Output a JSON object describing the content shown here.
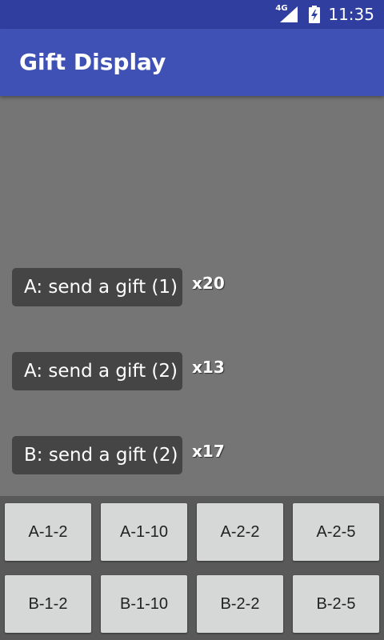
{
  "status_bar": {
    "network": "4G",
    "time": "11:35",
    "icons": [
      "signal-icon",
      "battery-charging-icon"
    ]
  },
  "app_bar": {
    "title": "Gift Display"
  },
  "gifts": [
    {
      "label": "A: send a gift (1)",
      "count": "x20"
    },
    {
      "label": "A: send a gift (2)",
      "count": "x13"
    },
    {
      "label": "B: send a gift (2)",
      "count": "x17"
    }
  ],
  "buttons": {
    "row1": [
      "A-1-2",
      "A-1-10",
      "A-2-2",
      "A-2-5"
    ],
    "row2": [
      "B-1-2",
      "B-1-10",
      "B-2-2",
      "B-2-5"
    ]
  },
  "colors": {
    "status_bar": "#303f9f",
    "app_bar": "#3f51b5",
    "background": "#757575",
    "gift_pill": "#454545",
    "button_panel": "#595959",
    "button": "#d6d7d7"
  }
}
